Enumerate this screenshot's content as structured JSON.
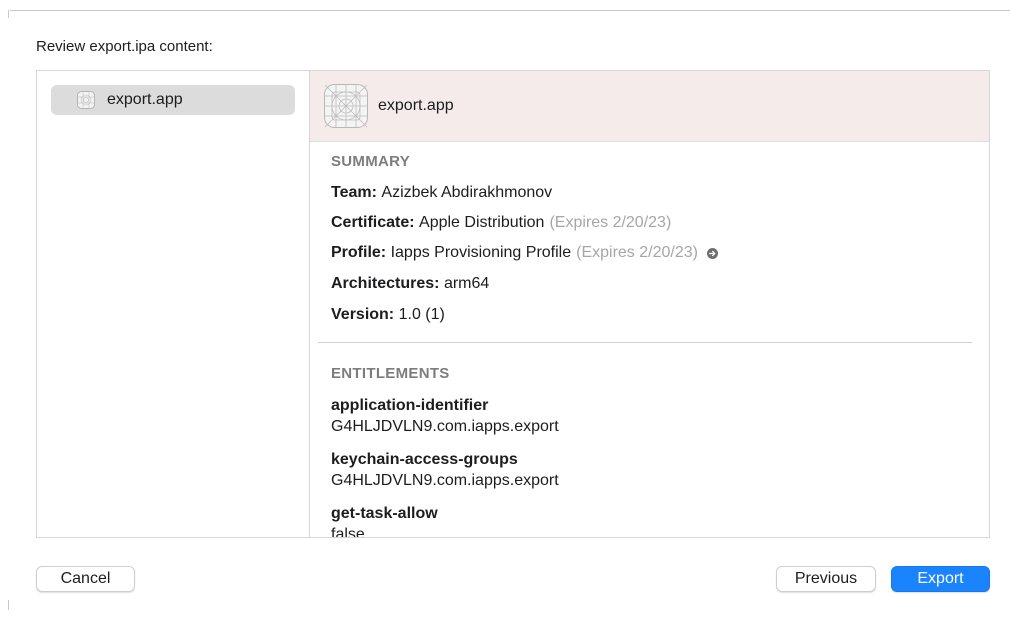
{
  "heading": "Review export.ipa content:",
  "sidebar": {
    "items": [
      {
        "label": "export.app",
        "icon": "app-placeholder-icon",
        "selected": true
      }
    ]
  },
  "detail": {
    "header": {
      "title": "export.app",
      "icon": "app-placeholder-icon",
      "background": "#f5ebeb"
    },
    "summary": {
      "title": "SUMMARY",
      "team": {
        "label": "Team:",
        "value": "Azizbek Abdirakhmonov"
      },
      "certificate": {
        "label": "Certificate:",
        "value": "Apple Distribution",
        "note": "(Expires 2/20/23)"
      },
      "profile": {
        "label": "Profile:",
        "value": "Iapps Provisioning Profile",
        "note": "(Expires 2/20/23)",
        "icon": "arrow-circle-right-icon"
      },
      "architectures": {
        "label": "Architectures:",
        "value": "arm64"
      },
      "version": {
        "label": "Version:",
        "value": "1.0 (1)"
      }
    },
    "entitlements": {
      "title": "ENTITLEMENTS",
      "items": [
        {
          "key": "application-identifier",
          "value": "G4HLJDVLN9.com.iapps.export"
        },
        {
          "key": "keychain-access-groups",
          "value": "G4HLJDVLN9.com.iapps.export"
        },
        {
          "key": "get-task-allow",
          "value": "false"
        }
      ]
    }
  },
  "buttons": {
    "cancel": "Cancel",
    "previous": "Previous",
    "export": "Export"
  },
  "colors": {
    "accent": "#1a84ff",
    "muted_text": "#a6a6a6",
    "section_title": "#7d7d7d"
  }
}
